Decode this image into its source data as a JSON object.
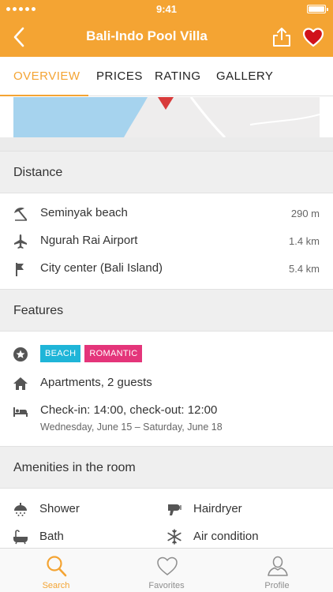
{
  "status_bar": {
    "time": "9:41"
  },
  "header": {
    "title": "Bali-Indo Pool Villa"
  },
  "tabs": [
    {
      "label": "OVERVIEW",
      "active": true
    },
    {
      "label": "PRICES",
      "active": false
    },
    {
      "label": "RATING",
      "active": false
    },
    {
      "label": "GALLERY",
      "active": false
    }
  ],
  "distance": {
    "heading": "Distance",
    "items": [
      {
        "icon": "beach-umbrella-icon",
        "label": "Seminyak beach",
        "value": "290 m"
      },
      {
        "icon": "airplane-icon",
        "label": "Ngurah Rai Airport",
        "value": "1.4 km"
      },
      {
        "icon": "flag-icon",
        "label": "City center (Bali Island)",
        "value": "5.4 km"
      }
    ]
  },
  "features": {
    "heading": "Features",
    "badges": [
      {
        "label": "BEACH",
        "color": "#1fb5d8"
      },
      {
        "label": "ROMANTIC",
        "color": "#e4357a"
      }
    ],
    "apartment": "Apartments, 2 guests",
    "checkin": "Check-in: 14:00, check-out: 12:00",
    "dates": "Wednesday, June 15 – Saturday, June 18"
  },
  "amenities": {
    "heading": "Amenities in the room",
    "items": [
      {
        "icon": "shower-icon",
        "label": "Shower"
      },
      {
        "icon": "hairdryer-icon",
        "label": "Hairdryer"
      },
      {
        "icon": "bath-icon",
        "label": "Bath"
      },
      {
        "icon": "snowflake-icon",
        "label": "Air condition"
      }
    ]
  },
  "tabbar": [
    {
      "label": "Search",
      "active": true
    },
    {
      "label": "Favorites",
      "active": false
    },
    {
      "label": "Profile",
      "active": false
    }
  ],
  "colors": {
    "accent": "#f4a433",
    "favorite": "#d0121b",
    "map_water": "#a6d3ee"
  }
}
